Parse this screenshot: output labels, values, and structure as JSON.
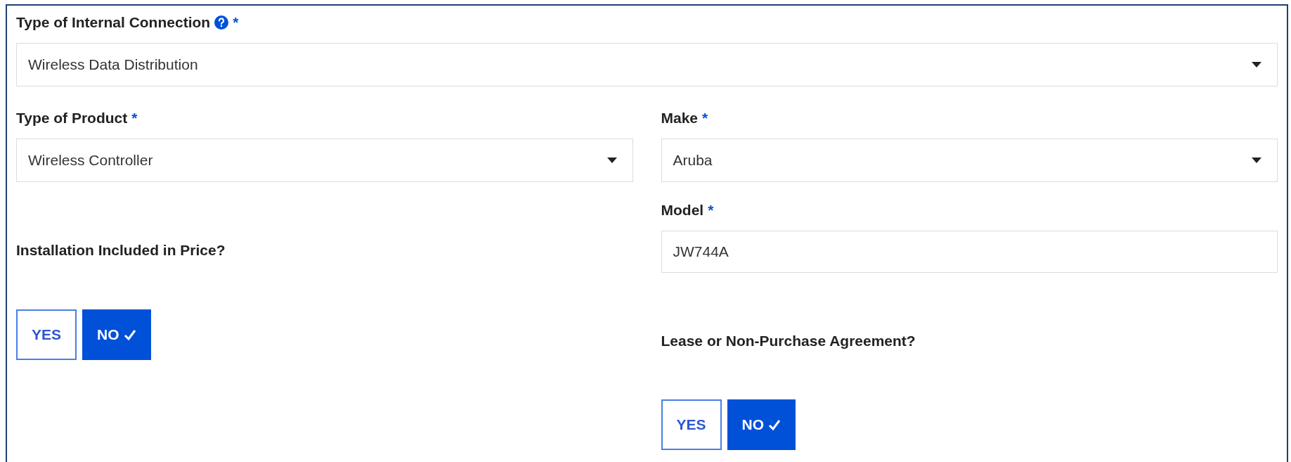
{
  "connection": {
    "label": "Type of Internal Connection",
    "required_mark": "*",
    "value": "Wireless Data Distribution"
  },
  "product": {
    "label": "Type of Product",
    "required_mark": "*",
    "value": "Wireless Controller"
  },
  "make": {
    "label": "Make",
    "required_mark": "*",
    "value": "Aruba"
  },
  "model": {
    "label": "Model",
    "required_mark": "*",
    "value": "JW744A"
  },
  "installation": {
    "label": "Installation Included in Price?",
    "options": [
      {
        "label": "YES",
        "selected": false
      },
      {
        "label": "NO",
        "selected": true
      }
    ]
  },
  "lease": {
    "label": "Lease or Non-Purchase Agreement?",
    "options": [
      {
        "label": "YES",
        "selected": false
      },
      {
        "label": "NO",
        "selected": true
      }
    ]
  }
}
